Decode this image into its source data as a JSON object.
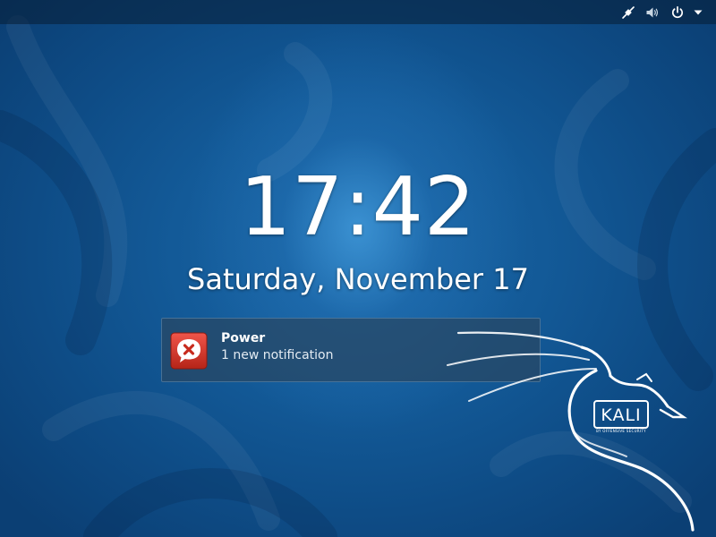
{
  "top_bar": {
    "indicators": [
      {
        "icon": "network-wired-icon"
      },
      {
        "icon": "volume-icon"
      },
      {
        "icon": "power-icon"
      },
      {
        "icon": "menu-arrow-down-icon"
      }
    ]
  },
  "clock": {
    "time": "17:42",
    "date": "Saturday, November 17"
  },
  "notification": {
    "icon": "error-chat-bubble-icon",
    "title": "Power",
    "body": "1 new notification"
  },
  "branding": {
    "logo": "kali-dragon-logo",
    "badge_text": "KALI",
    "badge_subtext": "BY OFFENSIVE SECURITY"
  },
  "colors": {
    "background_center": "#4aa6e0",
    "background_edge": "#0b3f74",
    "notification_icon": "#d23a2a",
    "text": "#ffffff"
  }
}
